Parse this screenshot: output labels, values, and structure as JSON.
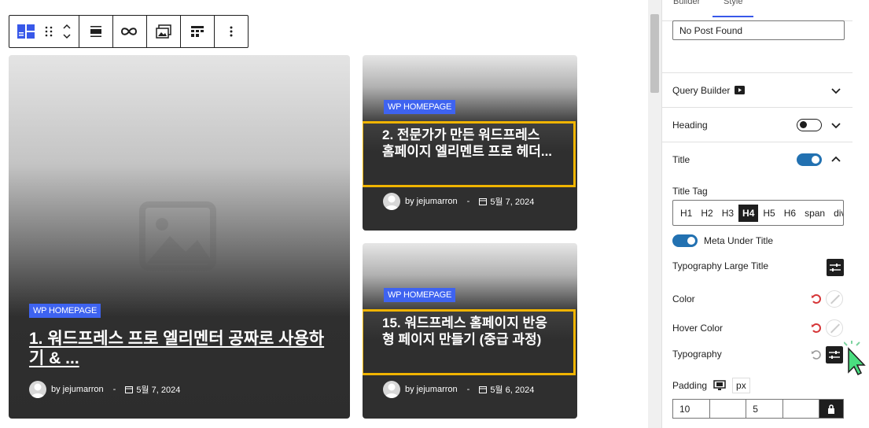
{
  "sidebar": {
    "tabs": [
      "Builder",
      "Style",
      ""
    ],
    "no_post_value": "No Post Found",
    "panels": {
      "query_builder": "Query Builder",
      "heading": "Heading",
      "title": "Title"
    },
    "title_tag": {
      "label": "Title Tag",
      "options": [
        "H1",
        "H2",
        "H3",
        "H4",
        "H5",
        "H6",
        "span",
        "div"
      ],
      "selected": "H4"
    },
    "meta_under_title": "Meta Under Title",
    "typography_large_title": "Typography Large Title",
    "color": "Color",
    "hover_color": "Hover Color",
    "typography": "Typography",
    "padding": {
      "label": "Padding",
      "unit": "px",
      "top": "10",
      "right": "",
      "bottom": "5",
      "left": ""
    },
    "toggles": {
      "heading": false,
      "title": true,
      "meta_under_title": true
    }
  },
  "posts": [
    {
      "category": "WP HOMEPAGE",
      "title": "1. 워드프레스 프로 엘리멘터 공짜로 사용하기 & ...",
      "author": "by jejumarron",
      "separator": "-",
      "date": "5월 7, 2024"
    },
    {
      "category": "WP HOMEPAGE",
      "title": "2. 전문가가 만든 워드프레스 홈페이지 엘리멘트 프로 헤더...",
      "author": "by jejumarron",
      "separator": "-",
      "date": "5월 7, 2024"
    },
    {
      "category": "WP HOMEPAGE",
      "title": "15. 워드프레스 홈페이지 반응형 페이지 만들기 (중급 과정)",
      "author": "by jejumarron",
      "separator": "-",
      "date": "5월 6, 2024"
    }
  ],
  "colors": {
    "badge": "#3e63f0",
    "highlight": "#f0b400",
    "toggle_on": "#2271b1",
    "reset": "#d63638"
  },
  "icons": [
    "block-icon",
    "drag-handle-icon",
    "move-icon",
    "align-icon",
    "link-icon",
    "featured-image-icon",
    "layout-icon",
    "more-options-icon"
  ]
}
